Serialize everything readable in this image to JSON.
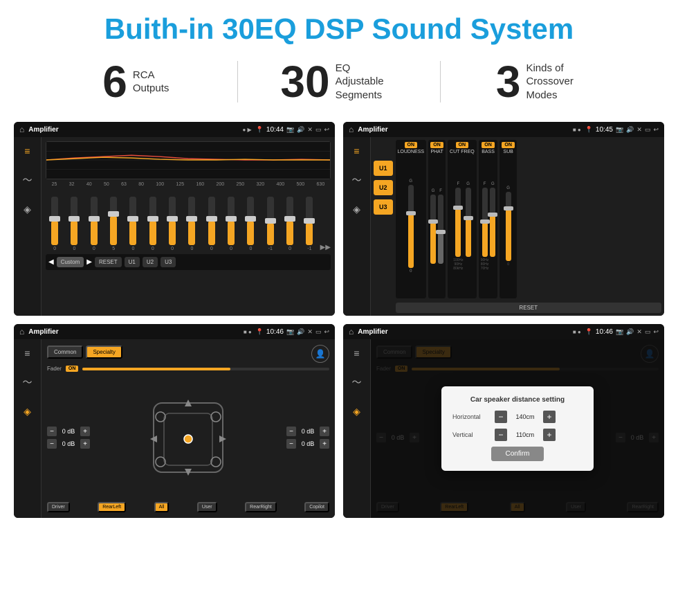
{
  "header": {
    "title": "Buith-in 30EQ DSP Sound System"
  },
  "stats": [
    {
      "number": "6",
      "label_line1": "RCA",
      "label_line2": "Outputs"
    },
    {
      "number": "30",
      "label_line1": "EQ Adjustable",
      "label_line2": "Segments"
    },
    {
      "number": "3",
      "label_line1": "Kinds of",
      "label_line2": "Crossover Modes"
    }
  ],
  "screens": {
    "eq_screen": {
      "status_title": "Amplifier",
      "time": "10:44",
      "eq_freqs": [
        "25",
        "32",
        "40",
        "50",
        "63",
        "80",
        "100",
        "125",
        "160",
        "200",
        "250",
        "320",
        "400",
        "500",
        "630"
      ],
      "eq_values": [
        "0",
        "0",
        "0",
        "5",
        "0",
        "0",
        "0",
        "0",
        "0",
        "0",
        "0",
        "-1",
        "0",
        "-1"
      ],
      "preset": "Custom",
      "buttons": [
        "RESET",
        "U1",
        "U2",
        "U3"
      ]
    },
    "crossover_screen": {
      "status_title": "Amplifier",
      "time": "10:45",
      "u_buttons": [
        "U1",
        "U2",
        "U3"
      ],
      "columns": [
        {
          "on_label": "ON",
          "title": "LOUDNESS"
        },
        {
          "on_label": "ON",
          "title": "PHAT"
        },
        {
          "on_label": "ON",
          "title": "CUT FREQ"
        },
        {
          "on_label": "ON",
          "title": "BASS"
        },
        {
          "on_label": "ON",
          "title": "SUB"
        }
      ],
      "reset_label": "RESET"
    },
    "speaker_screen": {
      "status_title": "Amplifier",
      "time": "10:46",
      "tabs": [
        "Common",
        "Specialty"
      ],
      "fader_label": "Fader",
      "fader_on": "ON",
      "labels": {
        "driver": "Driver",
        "copilot": "Copilot",
        "rear_left": "RearLeft",
        "all": "All",
        "user": "User",
        "rear_right": "RearRight"
      },
      "db_values": [
        "0 dB",
        "0 dB",
        "0 dB",
        "0 dB"
      ]
    },
    "distance_screen": {
      "status_title": "Amplifier",
      "time": "10:46",
      "tabs": [
        "Common",
        "Specialty"
      ],
      "dialog": {
        "title": "Car speaker distance setting",
        "horizontal_label": "Horizontal",
        "horizontal_value": "140cm",
        "vertical_label": "Vertical",
        "vertical_value": "110cm",
        "confirm_label": "Confirm"
      },
      "labels": {
        "driver": "Driver",
        "copilot": "Copilot",
        "rear_left": "RearLeft",
        "all": "All",
        "user": "User",
        "rear_right": "RearRight"
      },
      "db_values": [
        "0 dB",
        "0 dB"
      ]
    }
  }
}
